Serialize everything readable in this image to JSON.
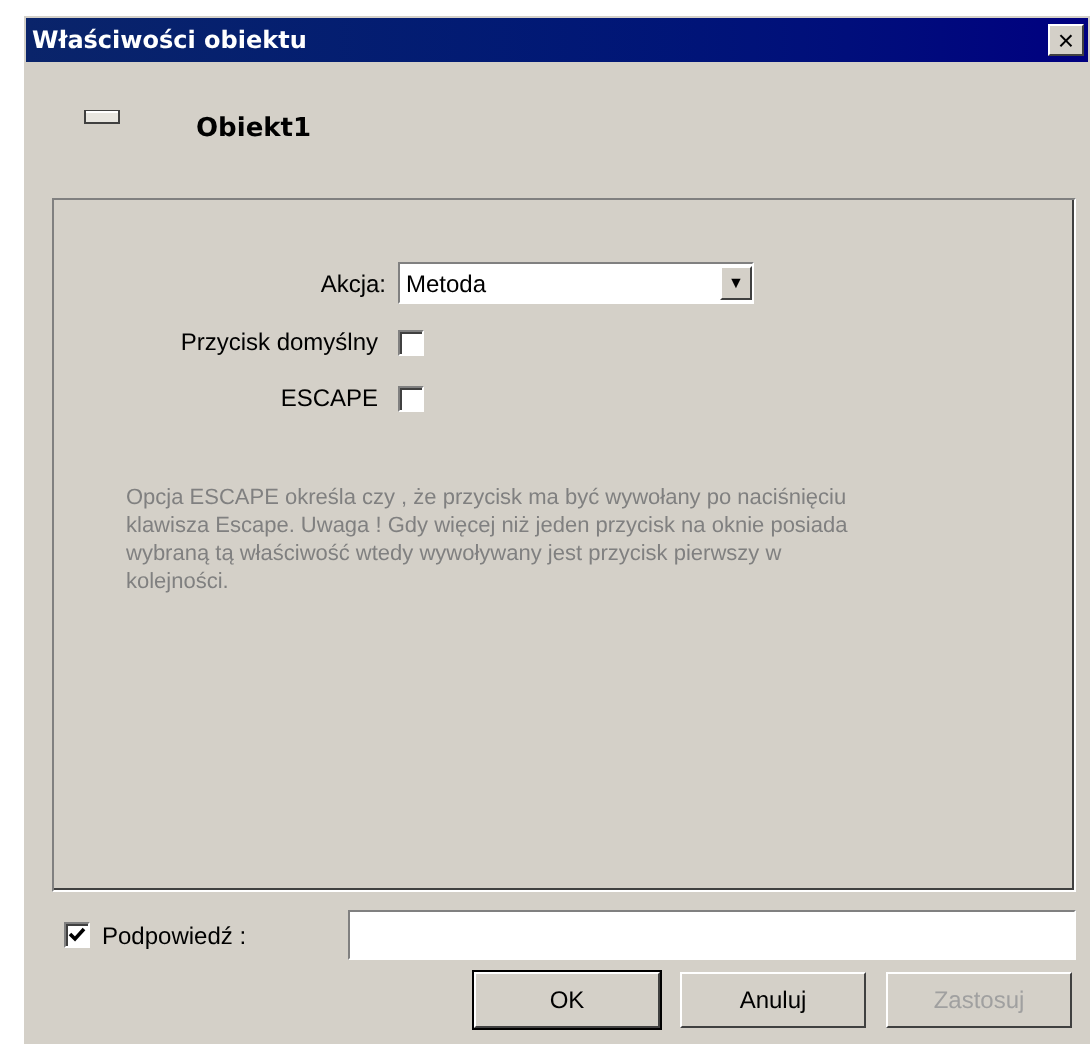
{
  "window": {
    "title": "Właściwości obiektu",
    "close": "×"
  },
  "object": {
    "name": "Obiekt1"
  },
  "action": {
    "label": "Akcja:",
    "value": "Metoda",
    "arrow": "▼"
  },
  "options": [
    {
      "label": "Przycisk domyślny",
      "checked": false
    },
    {
      "label": "ESCAPE",
      "checked": false
    }
  ],
  "description": "Opcja ESCAPE określa czy , że przycisk ma być wywołany po naciśnięciu klawisza Escape. Uwaga ! Gdy więcej niż jeden przycisk na oknie posiada wybraną tą właściwość wtedy wywoływany jest przycisk pierwszy w kolejności.",
  "hint": {
    "label": "Podpowiedź :",
    "checked": true
  },
  "buttons": [
    {
      "label": "OK",
      "disabled": false,
      "default": true
    },
    {
      "label": "Anuluj",
      "disabled": false,
      "default": false
    },
    {
      "label": "Zastosuj",
      "disabled": true,
      "default": false
    }
  ]
}
